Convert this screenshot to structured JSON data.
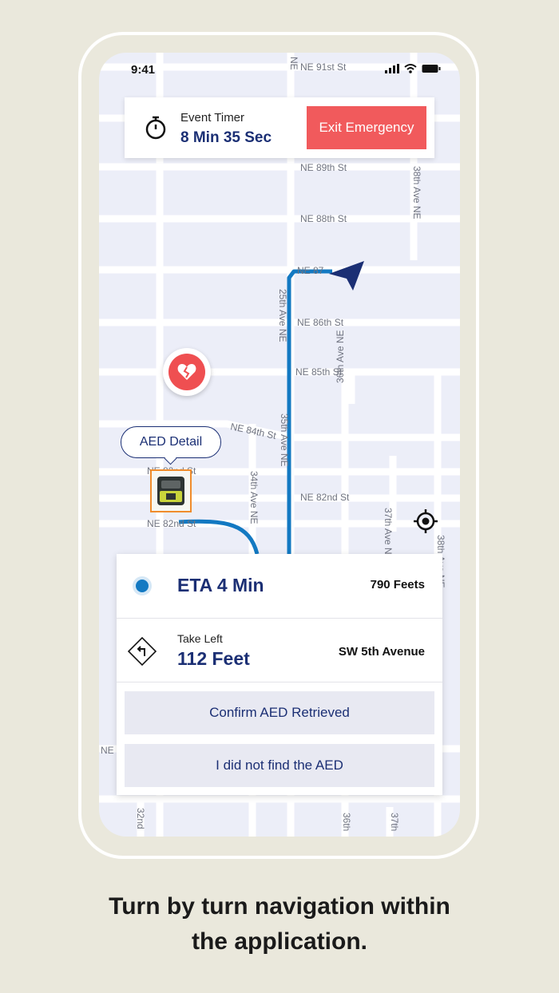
{
  "status_bar": {
    "time": "9:41"
  },
  "map": {
    "streets": [
      "NE 91st St",
      "NE 89th St",
      "NE 88th St",
      "NE 87",
      "NE 86th St",
      "NE 85th St",
      "NE 84th St",
      "NE 82nd St",
      "NE 82nd St",
      "NE 82nd St"
    ],
    "avenues": [
      "38th Ave NE",
      "25th Ave NE",
      "36th Ave NE",
      "35th Ave NE",
      "34th Ave NE",
      "37th Ave NE",
      "38th Ave NE",
      "NE",
      "NE",
      "32nd",
      "36th",
      "37th"
    ]
  },
  "timer": {
    "label": "Event Timer",
    "value": "8 Min 35 Sec",
    "exit_label": "Exit Emergency"
  },
  "aed": {
    "bubble_label": "AED Detail"
  },
  "navigation": {
    "eta": "ETA 4 Min",
    "eta_distance": "790 Feets",
    "turn_label": "Take Left",
    "turn_distance": "112 Feet",
    "turn_street": "SW 5th Avenue",
    "confirm_label": "Confirm AED Retrieved",
    "not_found_label": "I did not find the AED"
  },
  "caption": {
    "line1": "Turn by turn navigation within",
    "line2": "the application."
  },
  "colors": {
    "accent": "#1b2f74",
    "emergency": "#f15a5c",
    "route": "#1379c2",
    "background": "#eae8dc"
  }
}
